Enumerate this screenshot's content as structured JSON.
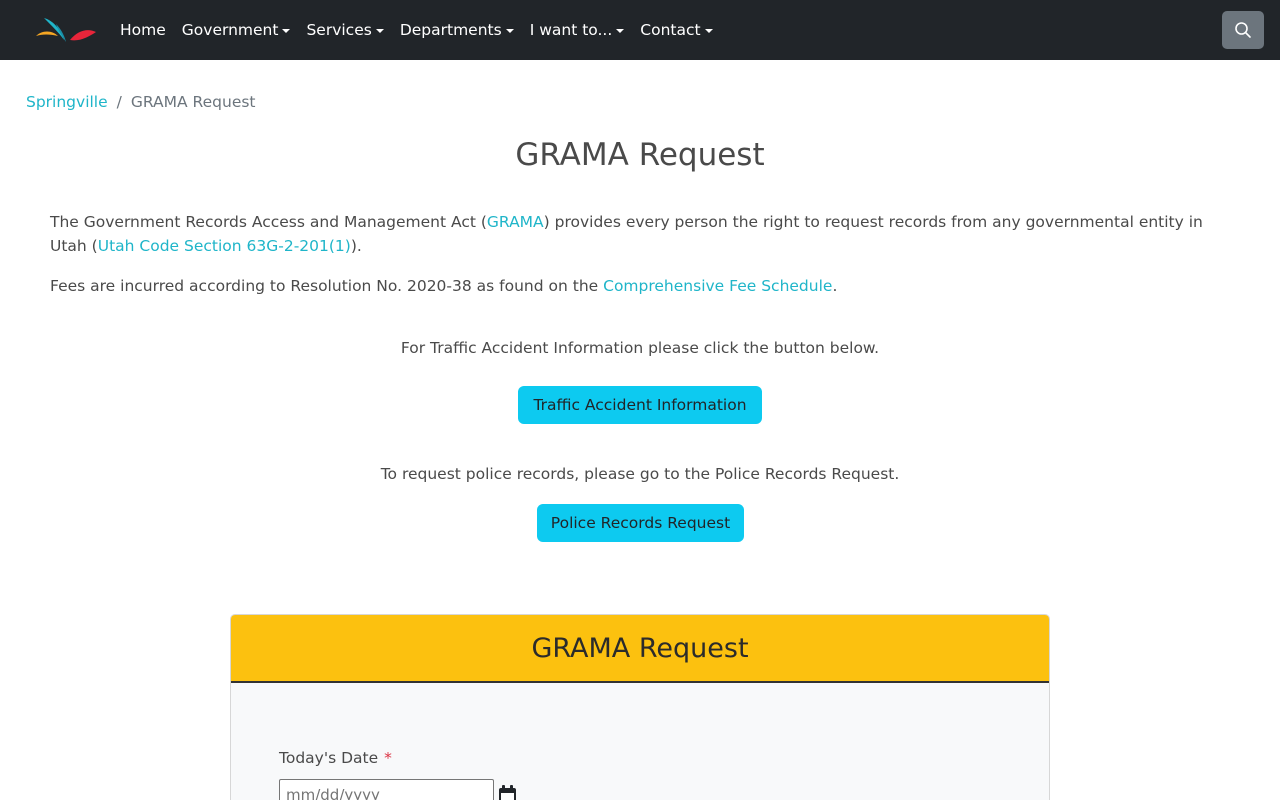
{
  "nav": {
    "items": [
      {
        "label": "Home",
        "dropdown": false
      },
      {
        "label": "Government",
        "dropdown": true
      },
      {
        "label": "Services",
        "dropdown": true
      },
      {
        "label": "Departments",
        "dropdown": true
      },
      {
        "label": "I want to...",
        "dropdown": true
      },
      {
        "label": "Contact",
        "dropdown": true
      }
    ],
    "search_icon": "search-icon",
    "logo_icon": "springville-logo"
  },
  "breadcrumb": {
    "home": "Springville",
    "separator": "/",
    "current": "GRAMA Request"
  },
  "page_title": "GRAMA Request",
  "intro": {
    "text_1": "The Government Records Access and Management Act (",
    "link_grama": "GRAMA",
    "text_2": ") provides every person the right to request records from any governmental entity in Utah (",
    "link_code": "Utah Code Section 63G-2-201(1)",
    "text_3": ")."
  },
  "fees": {
    "text_1": "Fees are incurred according to Resolution No. 2020-38 as found on the ",
    "link": "Comprehensive Fee Schedule",
    "text_2": "."
  },
  "traffic": {
    "text": "For Traffic Accident Information please click the button below.",
    "button": "Traffic Accident Information"
  },
  "police": {
    "text": "To request police records, please go to the Police Records Request.",
    "button": "Police Records Request"
  },
  "form": {
    "header": "GRAMA Request",
    "date_label": "Today's Date",
    "required_mark": "*",
    "date_placeholder": "mm/dd/yyyy",
    "calendar_icon": "calendar-icon"
  },
  "colors": {
    "navbar": "#212529",
    "link": "#1fb5c9",
    "button": "#0dcaf0",
    "card_header": "#fcc10f",
    "required": "#dc3545"
  }
}
